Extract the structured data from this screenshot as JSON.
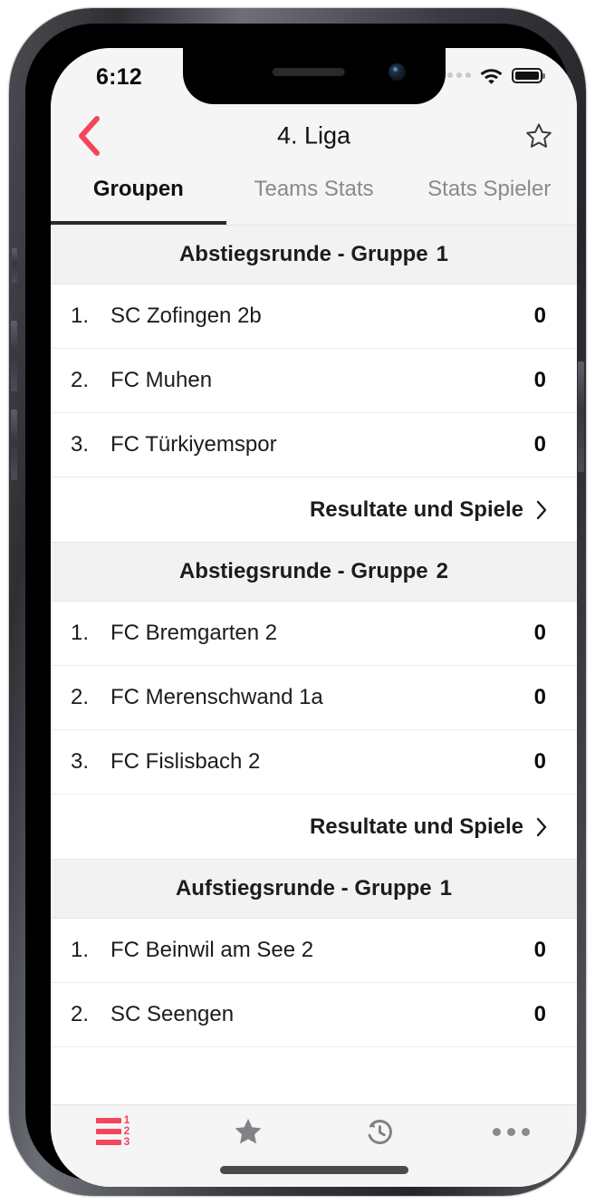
{
  "status_bar": {
    "time": "6:12",
    "signal_icon": "cellular-dots-icon",
    "wifi_icon": "wifi-icon",
    "battery_icon": "battery-full-icon"
  },
  "nav": {
    "back_icon": "chevron-left-icon",
    "title": "4. Liga",
    "favorite_icon": "star-outline-icon",
    "accent_color": "#F4455A"
  },
  "tabs": [
    {
      "label": "Groupen",
      "active": true
    },
    {
      "label": "Teams Stats",
      "active": false
    },
    {
      "label": "Stats Spieler",
      "active": false
    }
  ],
  "groups": [
    {
      "title": "Abstiegsrunde - Gruppe",
      "number": "1",
      "teams": [
        {
          "rank": "1.",
          "name": "SC Zofingen 2b",
          "points": "0"
        },
        {
          "rank": "2.",
          "name": "FC Muhen",
          "points": "0"
        },
        {
          "rank": "3.",
          "name": "FC Türkiyemspor",
          "points": "0"
        }
      ],
      "results_link": "Resultate und Spiele",
      "results_chevron_icon": "chevron-right-icon"
    },
    {
      "title": "Abstiegsrunde - Gruppe",
      "number": "2",
      "teams": [
        {
          "rank": "1.",
          "name": "FC Bremgarten 2",
          "points": "0"
        },
        {
          "rank": "2.",
          "name": "FC Merenschwand 1a",
          "points": "0"
        },
        {
          "rank": "3.",
          "name": "FC Fislisbach 2",
          "points": "0"
        }
      ],
      "results_link": "Resultate und Spiele",
      "results_chevron_icon": "chevron-right-icon"
    },
    {
      "title": "Aufstiegsrunde - Gruppe",
      "number": "1",
      "teams": [
        {
          "rank": "1.",
          "name": "FC Beinwil am See 2",
          "points": "0"
        },
        {
          "rank": "2.",
          "name": "SC Seengen",
          "points": "0"
        }
      ],
      "results_link": "",
      "results_chevron_icon": ""
    }
  ],
  "bottom_tabs": [
    {
      "icon": "ranking-list-icon",
      "active": true,
      "numbers": [
        "1",
        "2",
        "3"
      ]
    },
    {
      "icon": "star-filled-icon",
      "active": false
    },
    {
      "icon": "history-clock-icon",
      "active": false
    },
    {
      "icon": "more-dots-icon",
      "active": false
    }
  ],
  "home_indicator": "home-indicator"
}
